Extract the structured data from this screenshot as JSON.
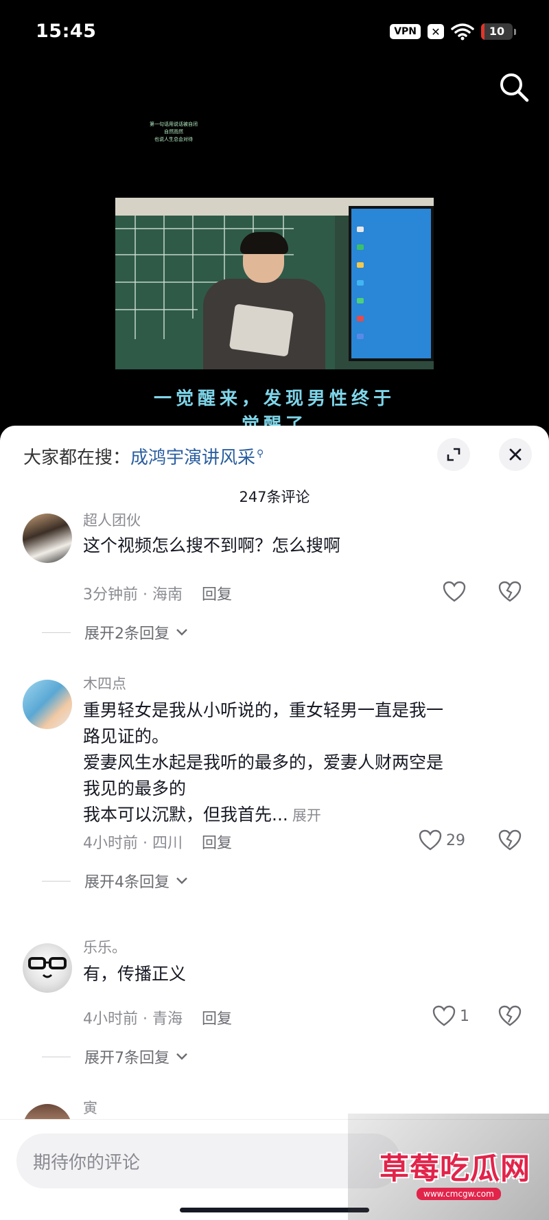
{
  "status_bar": {
    "time": "15:45",
    "vpn": "VPN",
    "x_badge": "✕",
    "battery": "10",
    "battery_level": 0.1
  },
  "video": {
    "tiny_caption": [
      "第一句话用说话被自闭",
      "自然而然",
      "也说人生总会对待"
    ],
    "caption_line1": "一觉醒来，发现男性终于",
    "caption_line2": "觉醒了"
  },
  "sheet": {
    "trending_prefix": "大家都在搜：",
    "trending_query": "成鸿宇演讲风采",
    "comment_count": "247条评论"
  },
  "comments": [
    {
      "username": "超人团伙",
      "lines": [
        "这个视频怎么搜不到啊？怎么搜啊"
      ],
      "time": "3分钟前",
      "location": "海南",
      "reply_label": "回复",
      "likes": "",
      "replies_label": "展开2条回复"
    },
    {
      "username": "木四点",
      "lines": [
        "重男轻女是我从小听说的，重女轻男一直是我一",
        "路见证的。",
        "爱妻风生水起是我听的最多的，爱妻人财两空是",
        "我见的最多的",
        "我本可以沉默，但我首先..."
      ],
      "expand_label": "展开",
      "time": "4小时前",
      "location": "四川",
      "reply_label": "回复",
      "likes": "29",
      "replies_label": "展开4条回复"
    },
    {
      "username": "乐乐。",
      "lines": [
        "有，传播正义"
      ],
      "time": "4小时前",
      "location": "青海",
      "reply_label": "回复",
      "likes": "1",
      "replies_label": "展开7条回复"
    },
    {
      "username": "寅"
    }
  ],
  "input": {
    "placeholder": "期待你的评论"
  },
  "watermark": {
    "main": "草莓吃瓜网",
    "url": "www.cmcgw.com"
  },
  "colors": {
    "link": "#2a5ea0",
    "caption": "#7fd6ea",
    "watermark": "#e2244a"
  }
}
